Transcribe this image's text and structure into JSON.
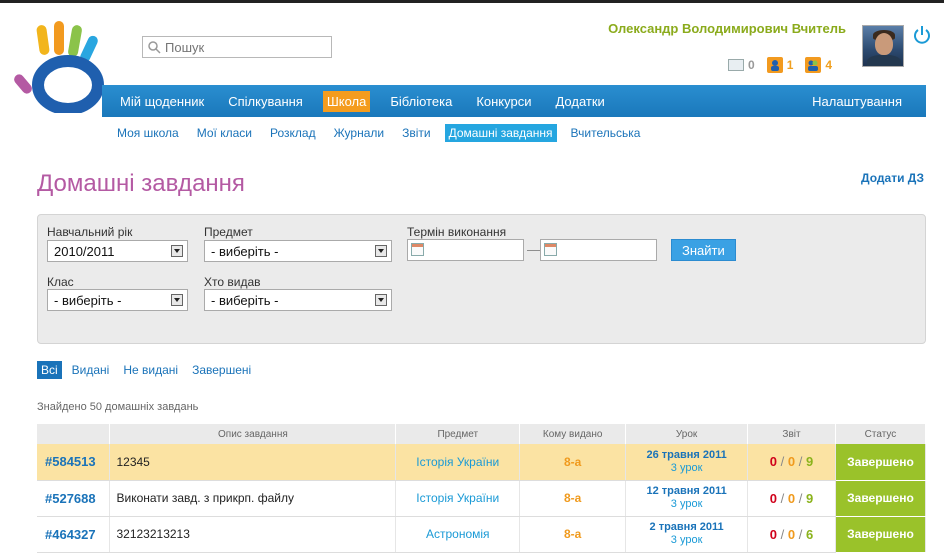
{
  "search": {
    "placeholder": "Пошук"
  },
  "user": {
    "name": "Олександр Володимирович Вчитель",
    "messages": "0",
    "notifications": "1",
    "friends": "4"
  },
  "main_nav": [
    "Мій щоденник",
    "Спілкування",
    "Школа",
    "Бібліотека",
    "Конкурси",
    "Додатки"
  ],
  "main_nav_right": "Налаштування",
  "sub_nav": [
    "Моя школа",
    "Мої класи",
    "Розклад",
    "Журнали",
    "Звіти",
    "Домашні завдання",
    "Вчительська"
  ],
  "page": {
    "title": "Домашні завдання",
    "add_link": "Додати ДЗ"
  },
  "filters": {
    "year_label": "Навчальний рік",
    "year_value": "2010/2011",
    "subject_label": "Предмет",
    "subject_value": "- виберіть -",
    "deadline_label": "Термін виконання",
    "dash": "—",
    "find_button": "Знайти",
    "class_label": "Клас",
    "class_value": "- виберіть -",
    "issuer_label": "Хто видав",
    "issuer_value": "- виберіть -"
  },
  "status_tabs": [
    "Всі",
    "Видані",
    "Не видані",
    "Завершені"
  ],
  "found_text": "Знайдено 50 домашніх завдань",
  "table": {
    "headers": [
      "",
      "Опис завдання",
      "Предмет",
      "Кому видано",
      "Урок",
      "Звіт",
      "Статус"
    ],
    "rows": [
      {
        "id": "#584513",
        "desc": "12345",
        "subject": "Історія України",
        "class": "8-а",
        "date": "26 травня 2011",
        "lesson": "3 урок",
        "r0": "0",
        "r1": "0",
        "r2": "9",
        "sep": "/",
        "status": "Завершено"
      },
      {
        "id": "#527688",
        "desc": "Виконати завд. з прикрп. файлу",
        "subject": "Історія України",
        "class": "8-а",
        "date": "12 травня 2011",
        "lesson": "3 урок",
        "r0": "0",
        "r1": "0",
        "r2": "9",
        "sep": "/",
        "status": "Завершено"
      },
      {
        "id": "#464327",
        "desc": "32123213213",
        "subject": "Астрономія",
        "class": "8-а",
        "date": "2 травня 2011",
        "lesson": "3 урок",
        "r0": "0",
        "r1": "0",
        "r2": "6",
        "sep": "/",
        "status": "Завершено"
      }
    ]
  },
  "colors": {
    "accent_blue": "#1a78bb",
    "active_orange": "#f49c1e",
    "title_purple": "#b45aa3",
    "status_green": "#9ac22a"
  }
}
